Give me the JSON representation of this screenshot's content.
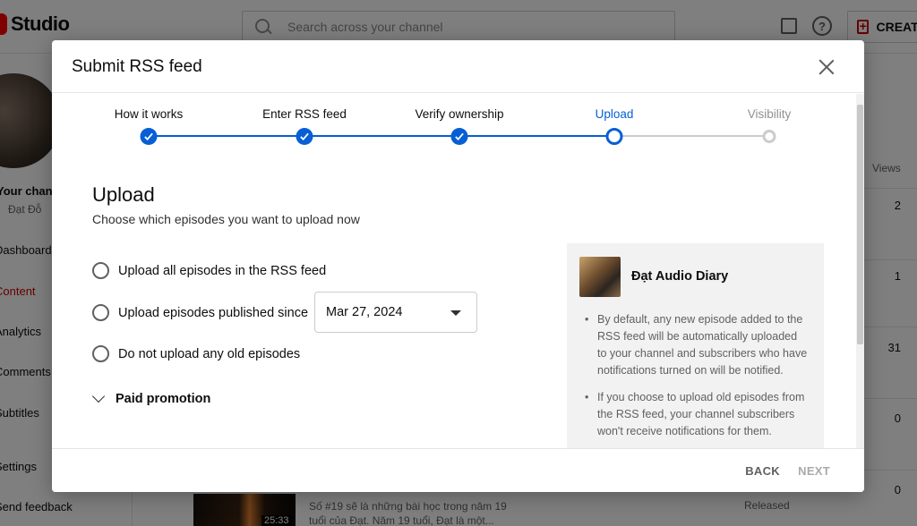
{
  "background": {
    "app_title": "Studio",
    "search_placeholder": "Search across your channel",
    "create_label": "CREATE",
    "channel_label": "Your channel",
    "owner_name": "Đạt Đỗ",
    "sidebar_items": [
      "Dashboard",
      "Content",
      "Analytics",
      "Comments",
      "Subtitles",
      "Settings",
      "Send feedback"
    ],
    "views_header": "Views",
    "view_values": [
      "2",
      "1",
      "31",
      "0",
      "0"
    ],
    "video_desc": "Số #19 sẽ là những bài học trong năm 19 tuổi của Đạt. Năm 19 tuổi, Đạt là một...",
    "video_duration": "25:33",
    "video_status": "Released"
  },
  "dialog": {
    "title": "Submit RSS feed",
    "steps": [
      {
        "label": "How it works",
        "state": "done"
      },
      {
        "label": "Enter RSS feed",
        "state": "done"
      },
      {
        "label": "Verify ownership",
        "state": "done"
      },
      {
        "label": "Upload",
        "state": "current"
      },
      {
        "label": "Visibility",
        "state": "future"
      }
    ],
    "section_title": "Upload",
    "section_subtitle": "Choose which episodes you want to upload now",
    "options": [
      {
        "label": "Upload all episodes in the RSS feed"
      },
      {
        "label": "Upload episodes published since"
      },
      {
        "label": "Do not upload any old episodes"
      }
    ],
    "date_value": "Mar 27, 2024",
    "paid_promotion": "Paid promotion",
    "info": {
      "podcast_name": "Đạt Audio Diary",
      "bullets": [
        "By default, any new episode added to the RSS feed will be automatically uploaded to your channel and subscribers who have notifications turned on will be notified.",
        "If you choose to upload old episodes from the RSS feed, your channel subscribers won't receive notifications for them."
      ]
    },
    "back_label": "BACK",
    "next_label": "NEXT"
  },
  "colors": {
    "accent": "#065fd4",
    "brand_red": "#ff0000",
    "inactive": "#cccccc"
  }
}
